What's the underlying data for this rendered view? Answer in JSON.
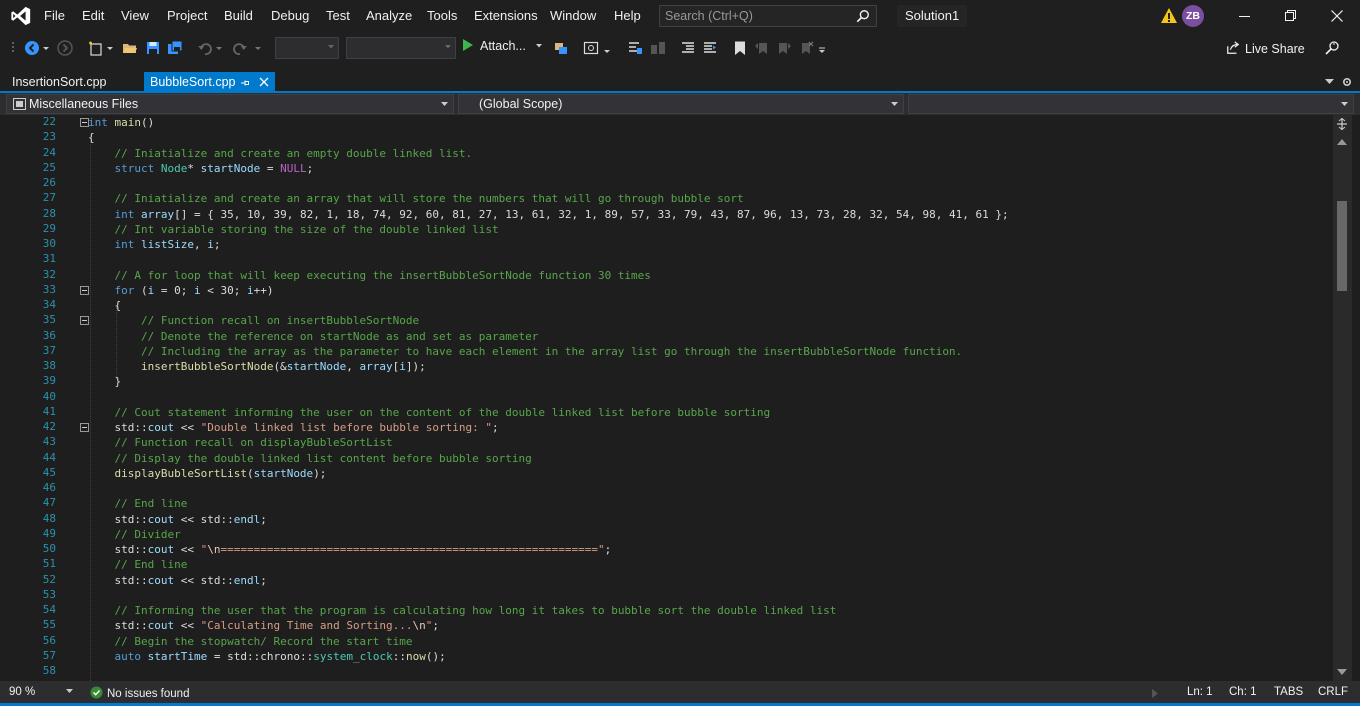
{
  "menubar": {
    "items": [
      "File",
      "Edit",
      "View",
      "Project",
      "Build",
      "Debug",
      "Test",
      "Analyze",
      "Tools",
      "Extensions",
      "Window",
      "Help"
    ],
    "search_placeholder": "Search (Ctrl+Q)",
    "solution_name": "Solution1",
    "user_initials": "ZB"
  },
  "toolbar": {
    "attach_label": "Attach...",
    "live_share_label": "Live Share"
  },
  "tabs": [
    {
      "label": "InsertionSort.cpp",
      "active": false
    },
    {
      "label": "BubbleSort.cpp",
      "active": true
    }
  ],
  "navbar": {
    "project_scope": "Miscellaneous Files",
    "global_scope": "(Global Scope)",
    "member_scope": ""
  },
  "editor": {
    "line_numbers": [
      22,
      23,
      24,
      25,
      26,
      27,
      28,
      29,
      30,
      31,
      32,
      33,
      34,
      35,
      36,
      37,
      38,
      39,
      40,
      41,
      42,
      43,
      44,
      45,
      46,
      47,
      48,
      49,
      50,
      51,
      52,
      53,
      54,
      55,
      56,
      57,
      58
    ],
    "lines": [
      "int main()",
      "{",
      "    // Iniatialize and create an empty double linked list.",
      "    struct Node* startNode = NULL;",
      "",
      "    // Iniatialize and create an array that will store the numbers that will go through bubble sort",
      "    int array[] = { 35, 10, 39, 82, 1, 18, 74, 92, 60, 81, 27, 13, 61, 32, 1, 89, 57, 33, 79, 43, 87, 96, 13, 73, 28, 32, 54, 98, 41, 61 };",
      "    // Int variable storing the size of the double linked list",
      "    int listSize, i;",
      "",
      "    // A for loop that will keep executing the insertBubbleSortNode function 30 times",
      "    for (i = 0; i < 30; i++)",
      "    {",
      "        // Function recall on insertBubbleSortNode",
      "        // Denote the reference on startNode as and set as parameter",
      "        // Including the array as the parameter to have each element in the array list go through the insertBubbleSortNode function.",
      "        insertBubbleSortNode(&startNode, array[i]);",
      "    }",
      "",
      "    // Cout statement informing the user on the content of the double linked list before bubble sorting",
      "    std::cout << \"Double linked list before bubble sorting: \";",
      "    // Function recall on displayBubleSortList",
      "    // Display the double linked list content before bubble sorting",
      "    displayBubleSortList(startNode);",
      "",
      "    // End line",
      "    std::cout << std::endl;",
      "    // Divider",
      "    std::cout << \"\\n=========================================================\";",
      "    // End line",
      "    std::cout << std::endl;",
      "",
      "    // Informing the user that the program is calculating how long it takes to bubble sort the double linked list",
      "    std::cout << \"Calculating Time and Sorting...\\n\";",
      "    // Begin the stopwatch/ Record the start time",
      "    auto startTime = std::chrono::system_clock::now();",
      ""
    ]
  },
  "statusbar": {
    "zoom": "90 %",
    "issues": "No issues found",
    "line": "Ln: 1",
    "column": "Ch: 1",
    "indent": "TABS",
    "line_ending": "CRLF"
  },
  "colors": {
    "accent": "#007acc",
    "keyword": "#569cd6",
    "comment": "#57a64a",
    "string": "#d69d85",
    "line_number": "#2b91af"
  }
}
